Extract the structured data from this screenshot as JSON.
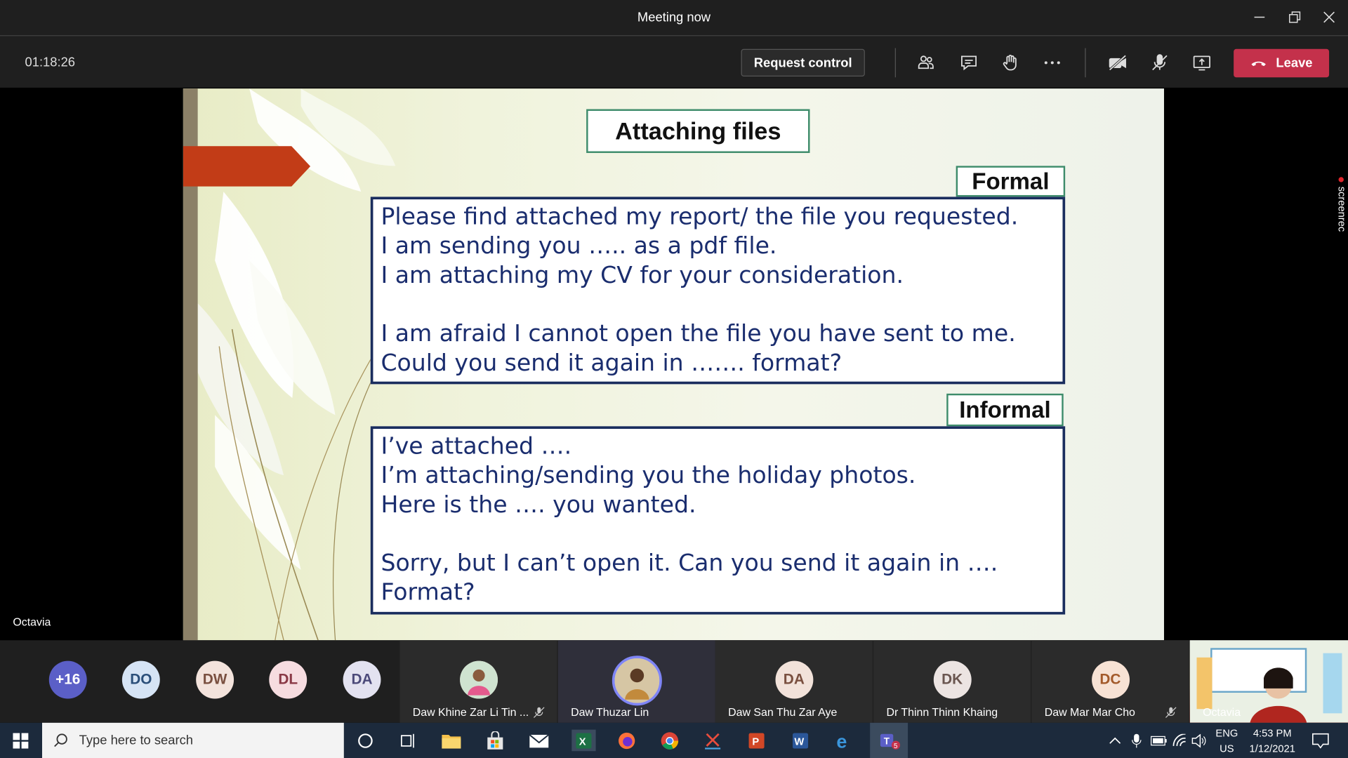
{
  "window": {
    "title": "Meeting now"
  },
  "toolbar": {
    "timer": "01:18:26",
    "request_control": "Request control",
    "leave": "Leave"
  },
  "slide": {
    "title": "Attaching files",
    "formal_label": "Formal",
    "formal_lines": [
      "Please find attached my report/ the file you requested.",
      "I am sending you ….. as a pdf file.",
      "I am attaching my CV for your consideration.",
      "",
      "I am afraid I cannot open the file you have sent to me.",
      "Could you send it again in ……. format?"
    ],
    "informal_label": "Informal",
    "informal_lines": [
      "I’ve attached ….",
      "I’m attaching/sending you the holiday photos.",
      "Here is the …. you wanted.",
      "",
      "Sorry, but I can’t open it. Can you send it again in ….",
      "Format?"
    ]
  },
  "presenter_name": "Octavia",
  "watermark": "screenrec",
  "participants": {
    "avatars": [
      {
        "initials": "+16",
        "color": "#5b5fc7"
      },
      {
        "initials": "DO",
        "color": "#d6e4f5"
      },
      {
        "initials": "DW",
        "color": "#f3e3dc"
      },
      {
        "initials": "DL",
        "color": "#f6dce0"
      },
      {
        "initials": "DA",
        "color": "#e3e2f0"
      }
    ],
    "tiles": [
      {
        "name": "Daw Khine Zar Li Tin ...",
        "muted": true
      },
      {
        "name": "Daw Thuzar Lin",
        "muted": false
      },
      {
        "name": "Daw San Thu Zar Aye",
        "initials": "DA",
        "muted": false
      },
      {
        "name": "Dr Thinn Thinn Khaing",
        "initials": "DK",
        "muted": false
      },
      {
        "name": "Daw Mar Mar Cho",
        "initials": "DC",
        "muted": true
      }
    ],
    "self_name": "Octavia"
  },
  "taskbar": {
    "search_placeholder": "Type here to search",
    "lang": "ENG",
    "region": "US",
    "time": "4:53 PM",
    "date": "1/12/2021",
    "teams_badge": "5"
  }
}
